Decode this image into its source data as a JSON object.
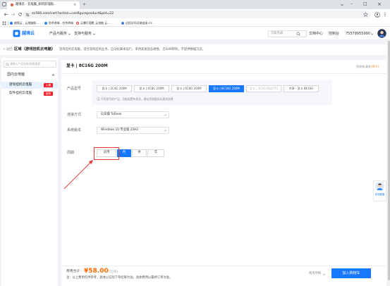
{
  "browser": {
    "tab": {
      "title": "越境云 - 云电脑_如何云电脑...",
      "close": "×"
    },
    "new_tab": "+",
    "window": {
      "minimize": "–",
      "maximize": "□",
      "close": "×"
    },
    "url": "ec566.com/cart?action=configureproduct&pid=22",
    "bookmarks": [
      "越境云 - 云电脑助...",
      "秒杀商城 - 秒杀商城",
      "云爆灯塔鹏_云电脑 云...",
      "远程访问远端连接 GT..."
    ]
  },
  "site": {
    "logo_text": "越境云",
    "nav": [
      "产品与服务",
      "支持与服务"
    ],
    "search_placeholder": "云服务器",
    "links": [
      "文档中心",
      "控制台"
    ],
    "account": "75579955990"
  },
  "breadcrumb": {
    "back": "< 返回",
    "title": "区域（游戏挂机云电脑）",
    "desc": "游戏挂机云电脑，适合游戏挂机业务，自动化脚本运行，采用高速固态硬盘，无SVM转利，不提供数据沉淀。"
  },
  "sidebar": {
    "search_placeholder": "请输入产品名称/规格搜索",
    "group": "国内云电脑",
    "items": [
      {
        "label": "游戏挂机云电脑",
        "badge": "火爆",
        "selected": true
      },
      {
        "label": "软件挂机云电脑",
        "badge": "推荐",
        "selected": false
      }
    ]
  },
  "config": {
    "title": "显卡 | 8C16G 200M",
    "cart_label": "购物车清单",
    "cart_count": "(0个)",
    "model_label": "产品型号",
    "models": [
      {
        "label": "显卡 | 2C4G 200M",
        "state": "normal"
      },
      {
        "label": "显卡 | 4C8G 200M",
        "state": "normal"
      },
      {
        "label": "显卡 | 6C8G 200M",
        "state": "normal"
      },
      {
        "label": "显卡 | 8C16G 200M",
        "state": "selected"
      },
      {
        "label": "显卡 | 4C8G 四倍CPU",
        "state": "disabled"
      },
      {
        "label": "共享 · 显卡 8K16G",
        "state": "normal"
      }
    ],
    "model_tip": "不同型号的产品，功能配置有差异，建议您根据实际需求选择",
    "connect_label": "连接方式",
    "connect_value": "向日葵 ToDesk",
    "os_label": "系统版本",
    "os_value": "Windows 10 专业版 22H2",
    "period_label": "周期",
    "periods": [
      "试用",
      "月",
      "季",
      "年"
    ],
    "selected_period": "月"
  },
  "footer": {
    "total_label": "费用合计：",
    "price": "¥58.00",
    "per_day": "(7元/天)",
    "note": "注：以上费用仅供参考，具体以实际下单结果为准，具体费用以最终订单为准。",
    "detail": "费用明细",
    "add_cart": "加入购物车"
  },
  "float_widget": {
    "label": "在线客服"
  },
  "colors": {
    "accent": "#1677ff",
    "badge": "#f5222d",
    "price": "#ff6a00",
    "annotation": "#e53935"
  },
  "icons": [
    "tab-search-icon",
    "site-favicon",
    "close-icon",
    "plus-icon",
    "back-icon",
    "forward-icon",
    "reload-icon",
    "site-info-icon",
    "star-icon",
    "profile-icon",
    "menu-icon",
    "apps-icon",
    "search-icon",
    "chevron-down-icon",
    "chevron-up-icon",
    "info-icon",
    "avatar"
  ]
}
